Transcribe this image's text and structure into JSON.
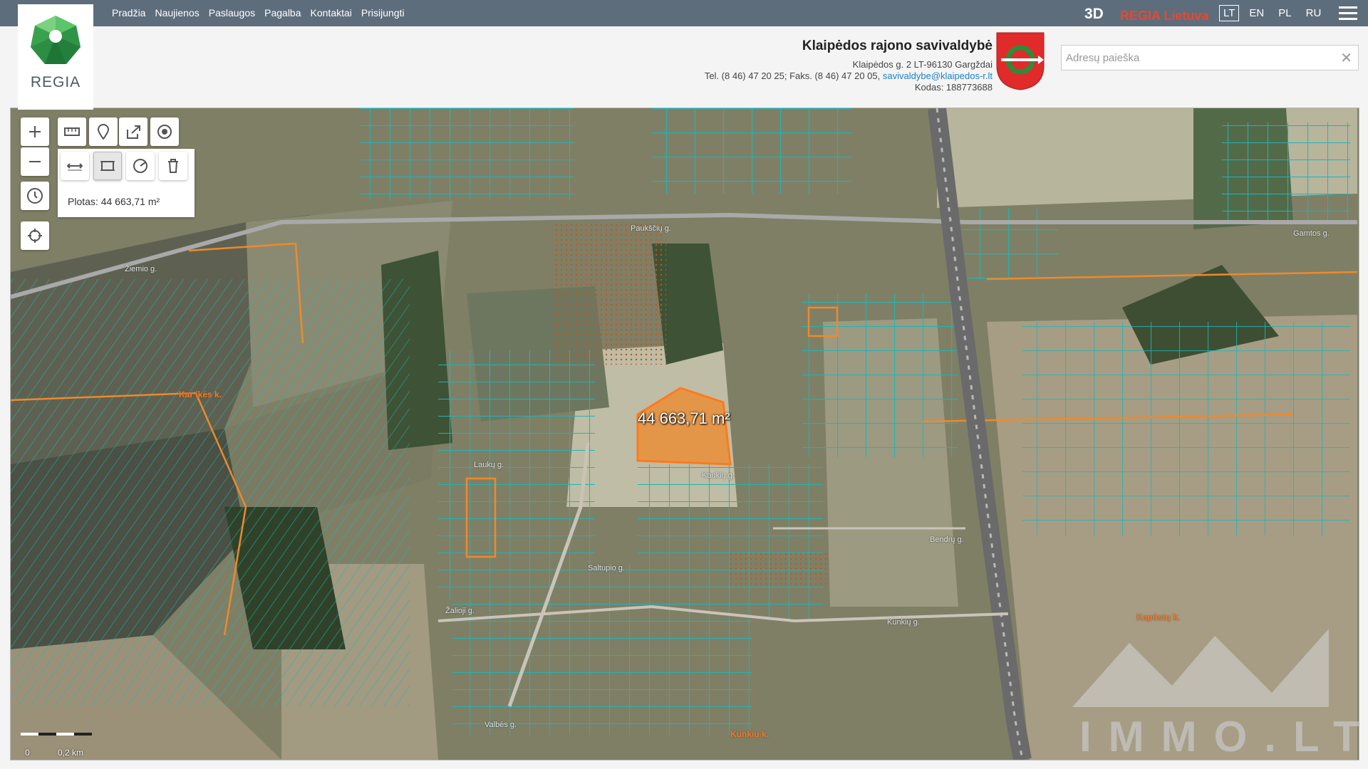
{
  "app": {
    "logo_text": "REGIA"
  },
  "nav": {
    "items": [
      "Pradžia",
      "Naujienos",
      "Paslaugos",
      "Pagalba",
      "Kontaktai",
      "Prisijungti"
    ]
  },
  "topbar": {
    "btn_3d": "3D",
    "regia_lietuva": "REGIA Lietuva",
    "languages": [
      "LT",
      "EN",
      "PL",
      "RU"
    ],
    "active_language": "LT"
  },
  "municipality": {
    "name": "Klaipėdos rajono savivaldybė",
    "address": "Klaipėdos g. 2 LT-96130 Gargždai",
    "phone_fax": "Tel. (8 46) 47 20 25; Faks. (8 46) 47 20 05,",
    "email": "savivaldybe@klaipedos-r.lt",
    "code": "Kodas: 188773688"
  },
  "search": {
    "placeholder": "Adresų paieška",
    "value": ""
  },
  "map": {
    "area_readout": "Plotas: 44 663,71 m²",
    "measured_area_label": "44 663,71 m²",
    "scale": {
      "zero": "0",
      "distance": "0,2 km"
    },
    "village_labels": [
      "Kar  ikės k.",
      "Kapūstų k.",
      "Kunkių k."
    ],
    "road_labels": [
      "Paukščių g.",
      "Laukų g.",
      "Saltupio g.",
      "Kaukių g.",
      "Bendrų g.",
      "Kunkių g.",
      "Žalioji g.",
      "Žiemio g.",
      "Gamtos g.",
      "Valbės g."
    ],
    "watermark": "IMMO.LT"
  },
  "colors": {
    "parcel": "#1fb5b5",
    "highlight": "#f0892a",
    "nav_bg": "#5d6d7c",
    "regia_red": "#e8482e"
  },
  "icons": {
    "tools": [
      "zoom-in-icon",
      "zoom-out-icon",
      "history-icon",
      "locate-icon",
      "ruler-icon",
      "pin-icon",
      "share-icon",
      "target-icon",
      "measure-line-icon",
      "measure-area-icon",
      "measure-circle-icon",
      "trash-icon"
    ]
  }
}
